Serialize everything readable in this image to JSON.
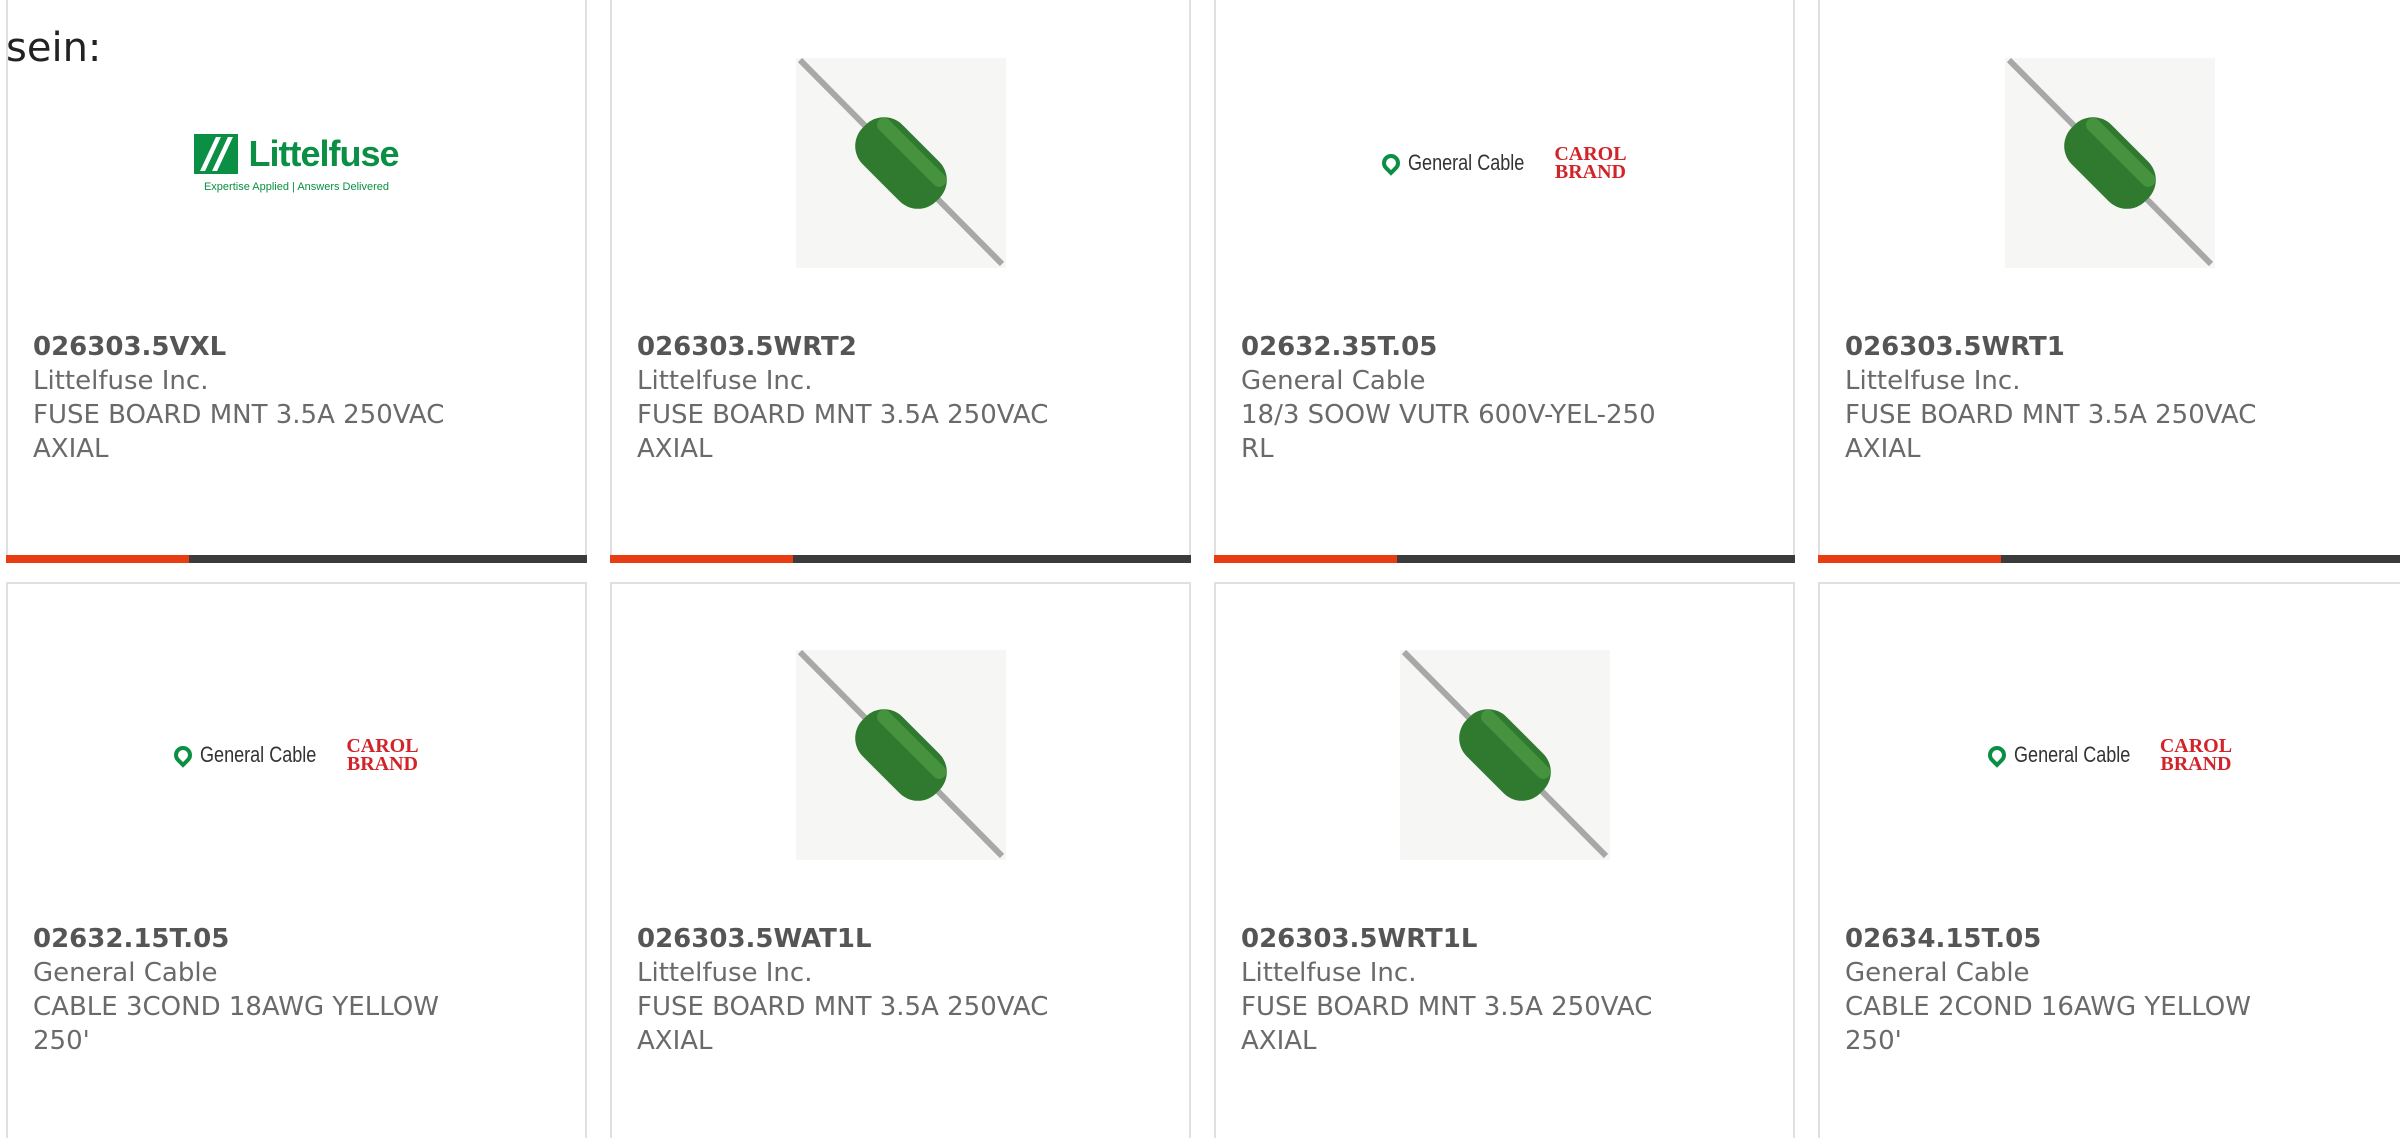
{
  "header": {
    "text": "sein:"
  },
  "logos": {
    "littelfuse": {
      "word": "Littelfuse",
      "tagline": "Expertise Applied | Answers Delivered"
    },
    "general_cable": {
      "word": "General Cable",
      "carol_line1": "CAROL",
      "carol_line2": "BRAND"
    }
  },
  "colors": {
    "accent": "#ea3c12",
    "bar": "#3b3b3b",
    "fuse_green": "#2f7a2f",
    "brand_green": "#0a8f44",
    "brand_red": "#d2232a"
  },
  "products": [
    {
      "part": "026303.5VXL",
      "manufacturer": "Littelfuse Inc.",
      "description": "FUSE BOARD MNT 3.5A 250VAC AXIAL",
      "image": "littelfuse-logo"
    },
    {
      "part": "026303.5WRT2",
      "manufacturer": "Littelfuse Inc.",
      "description": "FUSE BOARD MNT 3.5A 250VAC AXIAL",
      "image": "axial-fuse"
    },
    {
      "part": "02632.35T.05",
      "manufacturer": "General Cable",
      "description": "18/3 SOOW VUTR 600V-YEL-250 RL",
      "image": "general-cable-logo"
    },
    {
      "part": "026303.5WRT1",
      "manufacturer": "Littelfuse Inc.",
      "description": "FUSE BOARD MNT 3.5A 250VAC AXIAL",
      "image": "axial-fuse"
    },
    {
      "part": "02632.15T.05",
      "manufacturer": "General Cable",
      "description": "CABLE 3COND 18AWG YELLOW 250'",
      "image": "general-cable-logo"
    },
    {
      "part": "026303.5WAT1L",
      "manufacturer": "Littelfuse Inc.",
      "description": "FUSE BOARD MNT 3.5A 250VAC AXIAL",
      "image": "axial-fuse"
    },
    {
      "part": "026303.5WRT1L",
      "manufacturer": "Littelfuse Inc.",
      "description": "FUSE BOARD MNT 3.5A 250VAC AXIAL",
      "image": "axial-fuse"
    },
    {
      "part": "02634.15T.05",
      "manufacturer": "General Cable",
      "description": "CABLE 2COND 16AWG YELLOW 250'",
      "image": "general-cable-logo"
    }
  ]
}
